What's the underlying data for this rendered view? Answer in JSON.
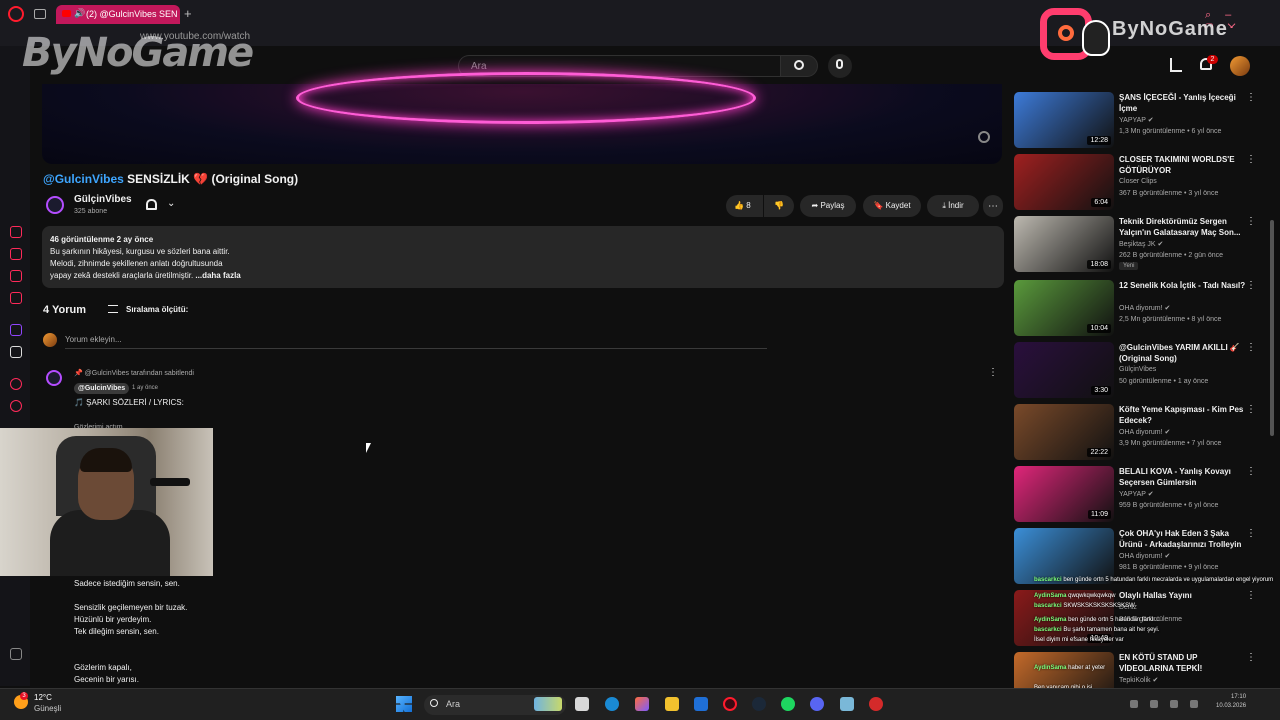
{
  "browser": {
    "tab_title": "(2) @GulcinVibes SEN",
    "new_tab": "+",
    "url": "www.youtube.com/watch"
  },
  "watermark": {
    "left_logo": "ByNoGame",
    "right_logo_text": "ByNoGame"
  },
  "header": {
    "search_placeholder": "Ara",
    "notification_count": "2"
  },
  "video": {
    "title_prefix": "@GulcinVibes",
    "title_rest": " SENSİZLİK 💔 (Original Song)",
    "channel_name": "GülçinVibes",
    "subscribers": "325 abone",
    "likes": "8",
    "share_label": "Paylaş",
    "save_label": "Kaydet",
    "download_label": "İndir"
  },
  "description": {
    "meta": "46 görüntülenme  2 ay önce",
    "line1": "Bu şarkının hikâyesi, kurgusu ve sözleri bana aittir.",
    "line2": "Melodi, zihnimde şekillenen anlatı doğrultusunda",
    "line3": "yapay zekâ destekli araçlarla üretilmiştir.",
    "more": "...daha fazla"
  },
  "comments": {
    "count_label": "4 Yorum",
    "sort_label": "Sıralama ölçütü:",
    "input_placeholder": "Yorum ekleyin...",
    "pinned_label": "@GulcinVibes tarafından sabitlendi",
    "author": "@GulcinVibes",
    "time": "1 ay önce",
    "heading": "🎵 ŞARKI SÖZLERİ / LYRICS:",
    "lyric_top": "Gözlerimi açtım",
    "lyrics": "Sadece istediğim sensin, sen.\n\nSensizlik geçilemeyen bir tuzak.\nHüzünlü bir yerdeyim.\nTek dileğim sensin, sen.\n\n\nGözlerim kapalı,\nGecenin bir yarısı."
  },
  "recommendations": [
    {
      "title": "ŞANS İÇECEĞİ - Yanlış İçeceği İçme",
      "channel": "YAPYAP ✔",
      "meta": "1,3 Mn görüntülenme • 6 yıl önce",
      "duration": "12:28",
      "color": "#3d7bd9"
    },
    {
      "title": "CLOSER TAKIMINI WORLDS'E GÖTÜRÜYOR",
      "channel": "Closer Clips",
      "meta": "367 B görüntülenme • 3 yıl önce",
      "duration": "6:04",
      "color": "#a02020"
    },
    {
      "title": "Teknik Direktörümüz Sergen Yalçın'ın Galatasaray Maç Son...",
      "channel": "Beşiktaş JK ✔",
      "meta": "262 B görüntülenme • 2 gün önce",
      "duration": "18:08",
      "color": "#bdb9b0",
      "badge": "Yeni"
    },
    {
      "title": "12 Senelik Kola İçtik - Tadı Nasıl?",
      "channel": "OHA diyorum! ✔",
      "meta": "2,5 Mn görüntülenme • 8 yıl önce",
      "duration": "10:04",
      "color": "#5a9a3c"
    },
    {
      "title": "@GulcinVibes  YARIM AKILLI 🎸 (Original Song)",
      "channel": "GülçinVibes",
      "meta": "50 görüntülenme • 1 ay önce",
      "duration": "3:30",
      "color": "#2a0f3d"
    },
    {
      "title": "Köfte Yeme Kapışması - Kim Pes Edecek?",
      "channel": "OHA diyorum! ✔",
      "meta": "3,9 Mn görüntülenme • 7 yıl önce",
      "duration": "22:22",
      "color": "#7a4a2a"
    },
    {
      "title": "BELALI KOVA - Yanlış Kovayı Seçersen Gümlersin",
      "channel": "YAPYAP ✔",
      "meta": "959 B görüntülenme • 6 yıl önce",
      "duration": "11:09",
      "color": "#e0267a"
    },
    {
      "title": "Çok OHA'yı Hak Eden 3 Şaka Ürünü - Arkadaşlarınızı Trolleyin",
      "channel": "OHA diyorum! ✔",
      "meta": "981 B görüntülenme • 9 yıl önce",
      "duration": "",
      "color": "#3b8fd8"
    },
    {
      "title": "Olaylı Hallas Yayını",
      "channel": "Deniz",
      "meta": "848 B görüntülenme",
      "duration": "10:48",
      "color": "#8a1a1a"
    },
    {
      "title": "EN KÖTÜ STAND UP VİDEOLARINA TEPKİ!",
      "channel": "TepkiKolik ✔",
      "meta": "",
      "duration": "",
      "color": "#c46a2a"
    }
  ],
  "chat": [
    {
      "name": "bascarkci",
      "text": "ben günde ortn 5 hatundan farklı mecralarda ve uygulamalardan engel yiyorum"
    },
    {
      "name": "AydinSama",
      "text": "qwqwkqwkqwkqw"
    },
    {
      "name": "bascarkci",
      "text": "SKWSKSKSKSKSKSKSW"
    },
    {
      "name": "AydinSama",
      "text": "ben günde ortn 5 hatundan farklı..."
    },
    {
      "name": "bascarkci",
      "text": "Bu şarkı tamamen bana ait her şeyi."
    },
    {
      "name": "",
      "text": "İlsel diyim mi efsane hikayeler var"
    },
    {
      "name": "AydinSama",
      "text": "haber at yeter"
    },
    {
      "name": "",
      "text": "Ben yapıcam gibi o işi."
    }
  ],
  "taskbar": {
    "weather_temp": "12°C",
    "weather_desc": "Güneşli",
    "weather_badge": "3",
    "search_label": "Ara",
    "time": "17:10",
    "date": "10.03.2026"
  }
}
